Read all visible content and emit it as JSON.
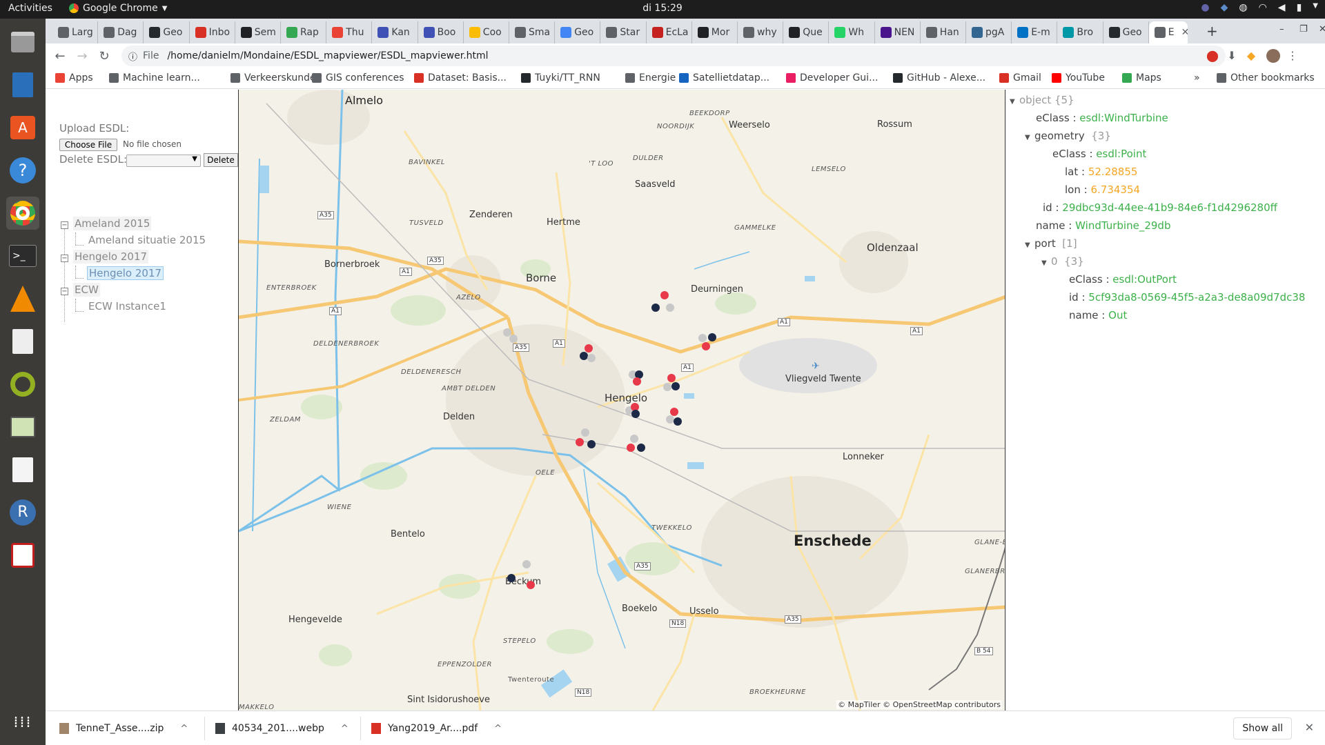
{
  "topbar": {
    "activities": "Activities",
    "app_name": "Google Chrome",
    "clock": "di 15:29"
  },
  "dock": {
    "items": [
      "files-icon",
      "writer-icon",
      "software-icon",
      "help-icon",
      "chrome-icon",
      "terminal-icon",
      "vlc-icon",
      "editor-icon",
      "qgis-icon",
      "image-viewer-icon",
      "text-editor-icon",
      "r-icon",
      "pdf-icon",
      "app-grid-icon"
    ]
  },
  "tabs": [
    {
      "label": "Larg",
      "color": "#5f6368"
    },
    {
      "label": "Dag",
      "color": "#5f6368"
    },
    {
      "label": "Geo",
      "color": "#24292e"
    },
    {
      "label": "Inbo",
      "color": "#d93025"
    },
    {
      "label": "Sem",
      "color": "#202124"
    },
    {
      "label": "Rap",
      "color": "#34a853"
    },
    {
      "label": "Thu",
      "color": "#ea4335"
    },
    {
      "label": "Kan",
      "color": "#3f51b5"
    },
    {
      "label": "Boo",
      "color": "#3f51b5"
    },
    {
      "label": "Coo",
      "color": "#fbbc04"
    },
    {
      "label": "Sma",
      "color": "#5f6368"
    },
    {
      "label": "Geo",
      "color": "#4285f4"
    },
    {
      "label": "Star",
      "color": "#5f6368"
    },
    {
      "label": "EcLa",
      "color": "#c5221f"
    },
    {
      "label": "Mor",
      "color": "#202124"
    },
    {
      "label": "why",
      "color": "#5f6368"
    },
    {
      "label": "Que",
      "color": "#202124"
    },
    {
      "label": "Wh",
      "color": "#25d366"
    },
    {
      "label": "NEN",
      "color": "#4a148c"
    },
    {
      "label": "Han",
      "color": "#5f6368"
    },
    {
      "label": "pgA",
      "color": "#336791"
    },
    {
      "label": "E-m",
      "color": "#0072c6"
    },
    {
      "label": "Bro",
      "color": "#0097a7"
    },
    {
      "label": "Geo",
      "color": "#24292e"
    },
    {
      "label": "E",
      "color": "#5f6368"
    }
  ],
  "toolbar": {
    "scheme": "File",
    "url": "/home/danielm/Mondaine/ESDL_mapviewer/ESDL_mapviewer.html"
  },
  "bookmarks": [
    {
      "label": "Apps",
      "color": "#ea4335"
    },
    {
      "label": "Machine learn...",
      "color": "#5f6368"
    },
    {
      "label": "Verkeerskunde",
      "color": "#5f6368"
    },
    {
      "label": "GIS conferences",
      "color": "#5f6368"
    },
    {
      "label": "Dataset: Basis...",
      "color": "#d93025"
    },
    {
      "label": "Tuyki/TT_RNN",
      "color": "#24292e"
    },
    {
      "label": "Energie",
      "color": "#5f6368"
    },
    {
      "label": "Satellietdatap...",
      "color": "#1565c0"
    },
    {
      "label": "Developer Gui...",
      "color": "#e91e63"
    },
    {
      "label": "GitHub - Alexe...",
      "color": "#24292e"
    },
    {
      "label": "Gmail",
      "color": "#d93025"
    },
    {
      "label": "YouTube",
      "color": "#ff0000"
    },
    {
      "label": "Maps",
      "color": "#34a853"
    }
  ],
  "bookmarks_more": "»",
  "other_bookmarks": "Other bookmarks",
  "left": {
    "upload_label": "Upload ESDL:",
    "choose_file": "Choose File",
    "no_file": "No file chosen",
    "delete_label": "Delete ESDL:",
    "delete_button": "Delete"
  },
  "tree": {
    "group1": "Ameland 2015",
    "group1_child": "Ameland situatie 2015",
    "group2": "Hengelo 2017",
    "group2_child": "Hengelo 2017",
    "group3": "ECW",
    "group3_child": "ECW Instance1"
  },
  "map": {
    "places": {
      "almelo": "Almelo",
      "weerselo": "Weerselo",
      "rossum": "Rossum",
      "saasveld": "Saasveld",
      "zenderen": "Zenderen",
      "hertme": "Hertme",
      "bornerbroek": "Bornerbroek",
      "borne": "Borne",
      "deurningen": "Deurningen",
      "oldenzaal": "Oldenzaal",
      "hengelo": "Hengelo",
      "vliegveld": "Vliegveld Twente",
      "delden": "Delden",
      "lonneker": "Lonneker",
      "enschede": "Enschede",
      "bentelo": "Bentelo",
      "beckum": "Beckum",
      "boekelo": "Boekelo",
      "usselo": "Usselo",
      "hengevelde": "Hengevelde",
      "sint_isidorushoeve": "Sint Isidorushoeve"
    },
    "areas": {
      "beekdorp": "BEEKDORP",
      "noordijk": "NOORDIJK",
      "dulder": "DULDER",
      "t_loo": "'T LOO",
      "lemselo": "LEMSELO",
      "bavinkel": "BAVINKEL",
      "tusveld": "TUSVELD",
      "gammelke": "GAMMELKE",
      "enterbroek": "ENTERBROEK",
      "azelo": "AZELO",
      "deldenerbroek": "DELDENERBROEK",
      "deldeneresch": "DELDENERESCH",
      "ambt_delden": "AMBT DELDEN",
      "zeldam": "ZELDAM",
      "oele": "OELE",
      "wiene": "WIENE",
      "twekkelo": "TWEKKELO",
      "glane_beek": "GLANE-BEEK",
      "glanerbrug": "GLANERBRUG",
      "stepelo": "STEPELO",
      "eppenzolder": "EPPENZOLDER",
      "twenteroute": "Twenteroute",
      "broekheurne": "BROEKHEURNE",
      "makkelo": "MAKKELO"
    },
    "roads": {
      "a35_1": "A35",
      "a35_2": "A35",
      "a1_1": "A1",
      "a1_2": "A1",
      "a35_3": "A35",
      "a1_3": "A1",
      "a1_4": "A1",
      "a1_5": "A1",
      "a1_6": "A1",
      "a35_4": "A35",
      "n18_1": "N18",
      "a35_5": "A35",
      "n18_2": "N18",
      "b54": "B 54"
    },
    "airport_icon": "airplane-icon",
    "attribution": "© MapTiler © OpenStreetMap contributors",
    "marker_colors": {
      "red": "#e8394b",
      "dark": "#1c2a48",
      "grey": "#c8c8c8"
    }
  },
  "json_view": {
    "root": "object",
    "root_count": "{5}",
    "eclass_key": "eClass :",
    "eclass_val": "esdl:WindTurbine",
    "geometry_key": "geometry",
    "geometry_count": "{3}",
    "geo_eclass_key": "eClass :",
    "geo_eclass_val": "esdl:Point",
    "lat_key": "lat :",
    "lat_val": "52.28855",
    "lon_key": "lon :",
    "lon_val": "6.734354",
    "id_key": "id :",
    "id_val": "29dbc93d-44ee-41b9-84e6-f1d4296280ff",
    "name_key": "name :",
    "name_val": "WindTurbine_29db",
    "port_key": "port",
    "port_count": "[1]",
    "port0_key": "0",
    "port0_count": "{3}",
    "port_eclass_key": "eClass :",
    "port_eclass_val": "esdl:OutPort",
    "port_id_key": "id :",
    "port_id_val": "5cf93da8-0569-45f5-a2a3-de8a09d7dc38",
    "port_name_key": "name :",
    "port_name_val": "Out"
  },
  "downloads": {
    "items": [
      {
        "label": "TenneT_Asse....zip",
        "color": "#a0856a"
      },
      {
        "label": "40534_201....webp",
        "color": "#3c4043"
      },
      {
        "label": "Yang2019_Ar....pdf",
        "color": "#d93025"
      }
    ],
    "show_all": "Show all"
  }
}
